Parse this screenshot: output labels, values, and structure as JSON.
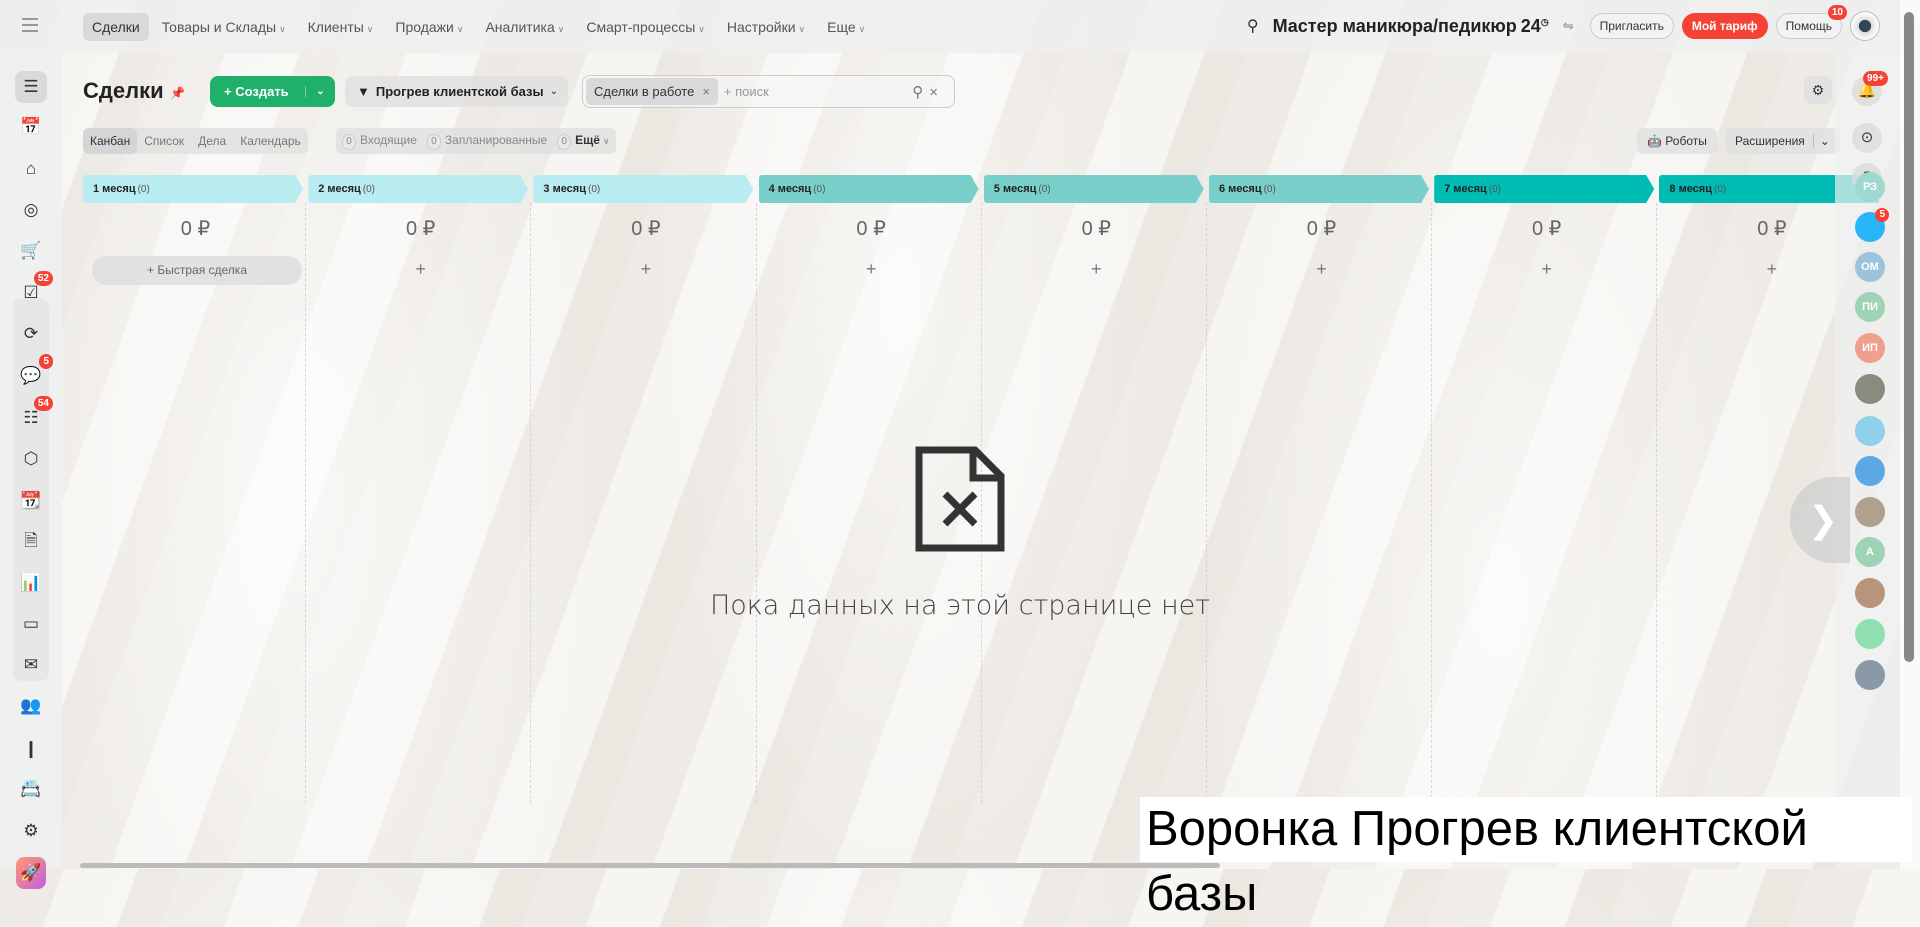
{
  "topnav": {
    "items": [
      {
        "label": "Сделки",
        "active": true
      },
      {
        "label": "Товары и Склады",
        "chevron": true
      },
      {
        "label": "Клиенты",
        "chevron": true
      },
      {
        "label": "Продажи",
        "chevron": true
      },
      {
        "label": "Аналитика",
        "chevron": true
      },
      {
        "label": "Смарт-процессы",
        "chevron": true
      },
      {
        "label": "Настройки",
        "chevron": true
      },
      {
        "label": "Еще",
        "chevron": true
      }
    ],
    "portal_name": "Мастер маникюра/педикюр",
    "portal_suffix": "24",
    "invite": "Пригласить",
    "tariff": "Мой тариф",
    "help": "Помощь",
    "help_badge": "10"
  },
  "sidebar": {
    "badges": {
      "tasks": "52",
      "chats": "5",
      "feed": "54"
    },
    "icons": [
      "funnel-icon",
      "calendar-list-icon",
      "warehouse-icon",
      "target-icon",
      "cart-icon",
      "tasks-icon",
      "sync-icon",
      "chat-icon",
      "feed-icon",
      "hexagon-icon",
      "calendar-icon",
      "document-icon",
      "presentation-icon",
      "drive-icon",
      "mail-icon",
      "team-icon",
      "analytics-icon",
      "contact-card-icon",
      "settings-icon",
      "rocket-icon"
    ]
  },
  "header": {
    "title": "Сделки",
    "create": "Создать",
    "funnel": "Прогрев клиентской базы",
    "filter_chip": "Сделки в работе",
    "search_placeholder": "+ поиск"
  },
  "views": {
    "tabs": [
      "Канбан",
      "Список",
      "Дела",
      "Календарь"
    ],
    "active": "Канбан"
  },
  "counters": [
    {
      "count": "0",
      "label": "Входящие"
    },
    {
      "count": "0",
      "label": "Запланированные"
    },
    {
      "count": "0",
      "label": "Ещё"
    }
  ],
  "tools": {
    "robots": "Роботы",
    "extensions": "Расширения"
  },
  "stages": [
    {
      "name": "1 месяц",
      "count": "(0)",
      "sum": "0 ₽",
      "color": "#b9ecf0"
    },
    {
      "name": "2 месяц",
      "count": "(0)",
      "sum": "0 ₽",
      "color": "#b9ecf0"
    },
    {
      "name": "3 месяц",
      "count": "(0)",
      "sum": "0 ₽",
      "color": "#b9ecf0"
    },
    {
      "name": "4 месяц",
      "count": "(0)",
      "sum": "0 ₽",
      "color": "#79cfca"
    },
    {
      "name": "5 месяц",
      "count": "(0)",
      "sum": "0 ₽",
      "color": "#79cfca"
    },
    {
      "name": "6 месяц",
      "count": "(0)",
      "sum": "0 ₽",
      "color": "#79cfca"
    },
    {
      "name": "7 месяц",
      "count": "(0)",
      "sum": "0 ₽",
      "color": "#00bdb4"
    },
    {
      "name": "8 месяц",
      "count": "(0)",
      "sum": "0 ₽",
      "color": "#00bdb4"
    }
  ],
  "quick_deal": "Быстрая сделка",
  "empty": {
    "text": "Пока данных на этой странице нет"
  },
  "rightbar": {
    "notif_badge": "99+",
    "chat_badge": "5",
    "avatars": [
      {
        "initials": "РЗ",
        "color": "#9fd8cf"
      },
      {
        "initials": "",
        "color": "#29b6f6"
      },
      {
        "initials": "ОМ",
        "color": "#9cc3dc"
      },
      {
        "initials": "ПИ",
        "color": "#9fd3b6"
      },
      {
        "initials": "ИП",
        "color": "#eea08c"
      },
      {
        "initials": "",
        "color": "#8a8a7e"
      },
      {
        "initials": "",
        "color": "#8fd0ea"
      },
      {
        "initials": "",
        "color": "#5aa9e6"
      },
      {
        "initials": "",
        "color": "#b0a090"
      },
      {
        "initials": "А",
        "color": "#9fd3b6"
      },
      {
        "initials": "",
        "color": "#b8957a"
      },
      {
        "initials": "",
        "color": "#8fe0b0"
      },
      {
        "initials": "",
        "color": "#8a99a8"
      }
    ]
  },
  "caption": "Воронка Прогрев клиентской базы"
}
